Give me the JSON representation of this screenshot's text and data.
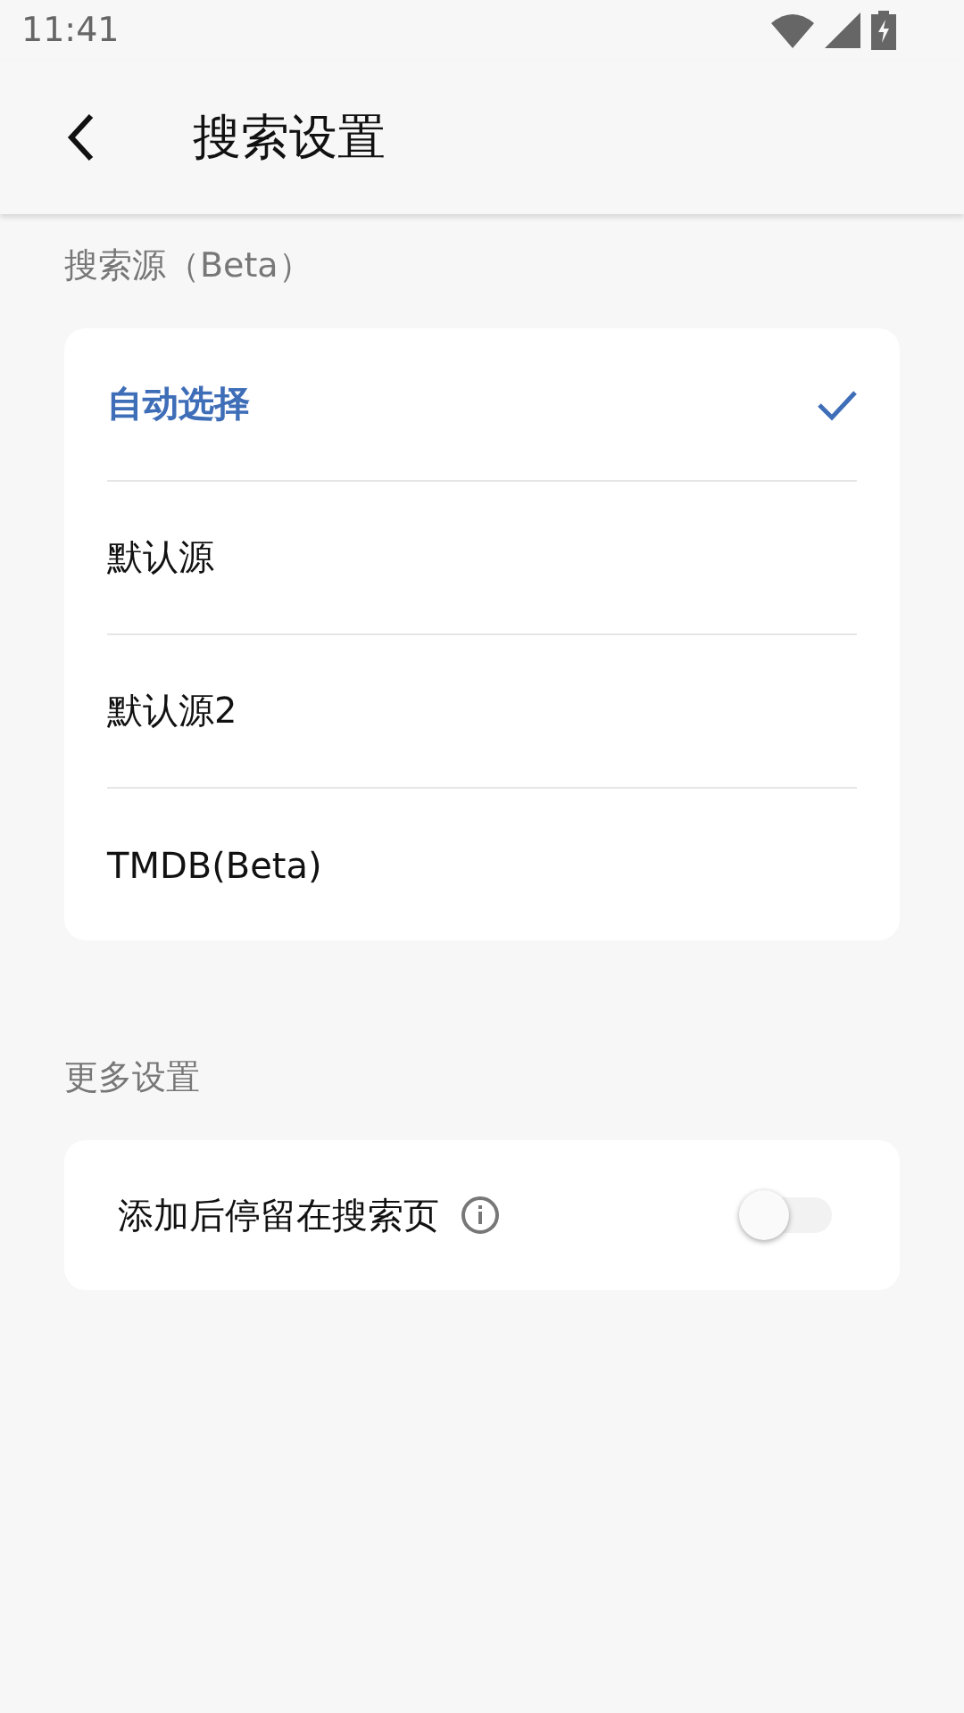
{
  "status_bar": {
    "time": "11:41"
  },
  "app_bar": {
    "title": "搜索设置"
  },
  "sections": [
    {
      "header": "搜索源（Beta）",
      "kind": "options",
      "options": [
        {
          "label": "自动选择",
          "selected": true
        },
        {
          "label": "默认源",
          "selected": false
        },
        {
          "label": "默认源2",
          "selected": false
        },
        {
          "label": "TMDB(Beta)",
          "selected": false
        }
      ]
    },
    {
      "header": "更多设置",
      "kind": "switches",
      "switches": [
        {
          "label": "添加后停留在搜索页",
          "on": false
        }
      ]
    }
  ]
}
